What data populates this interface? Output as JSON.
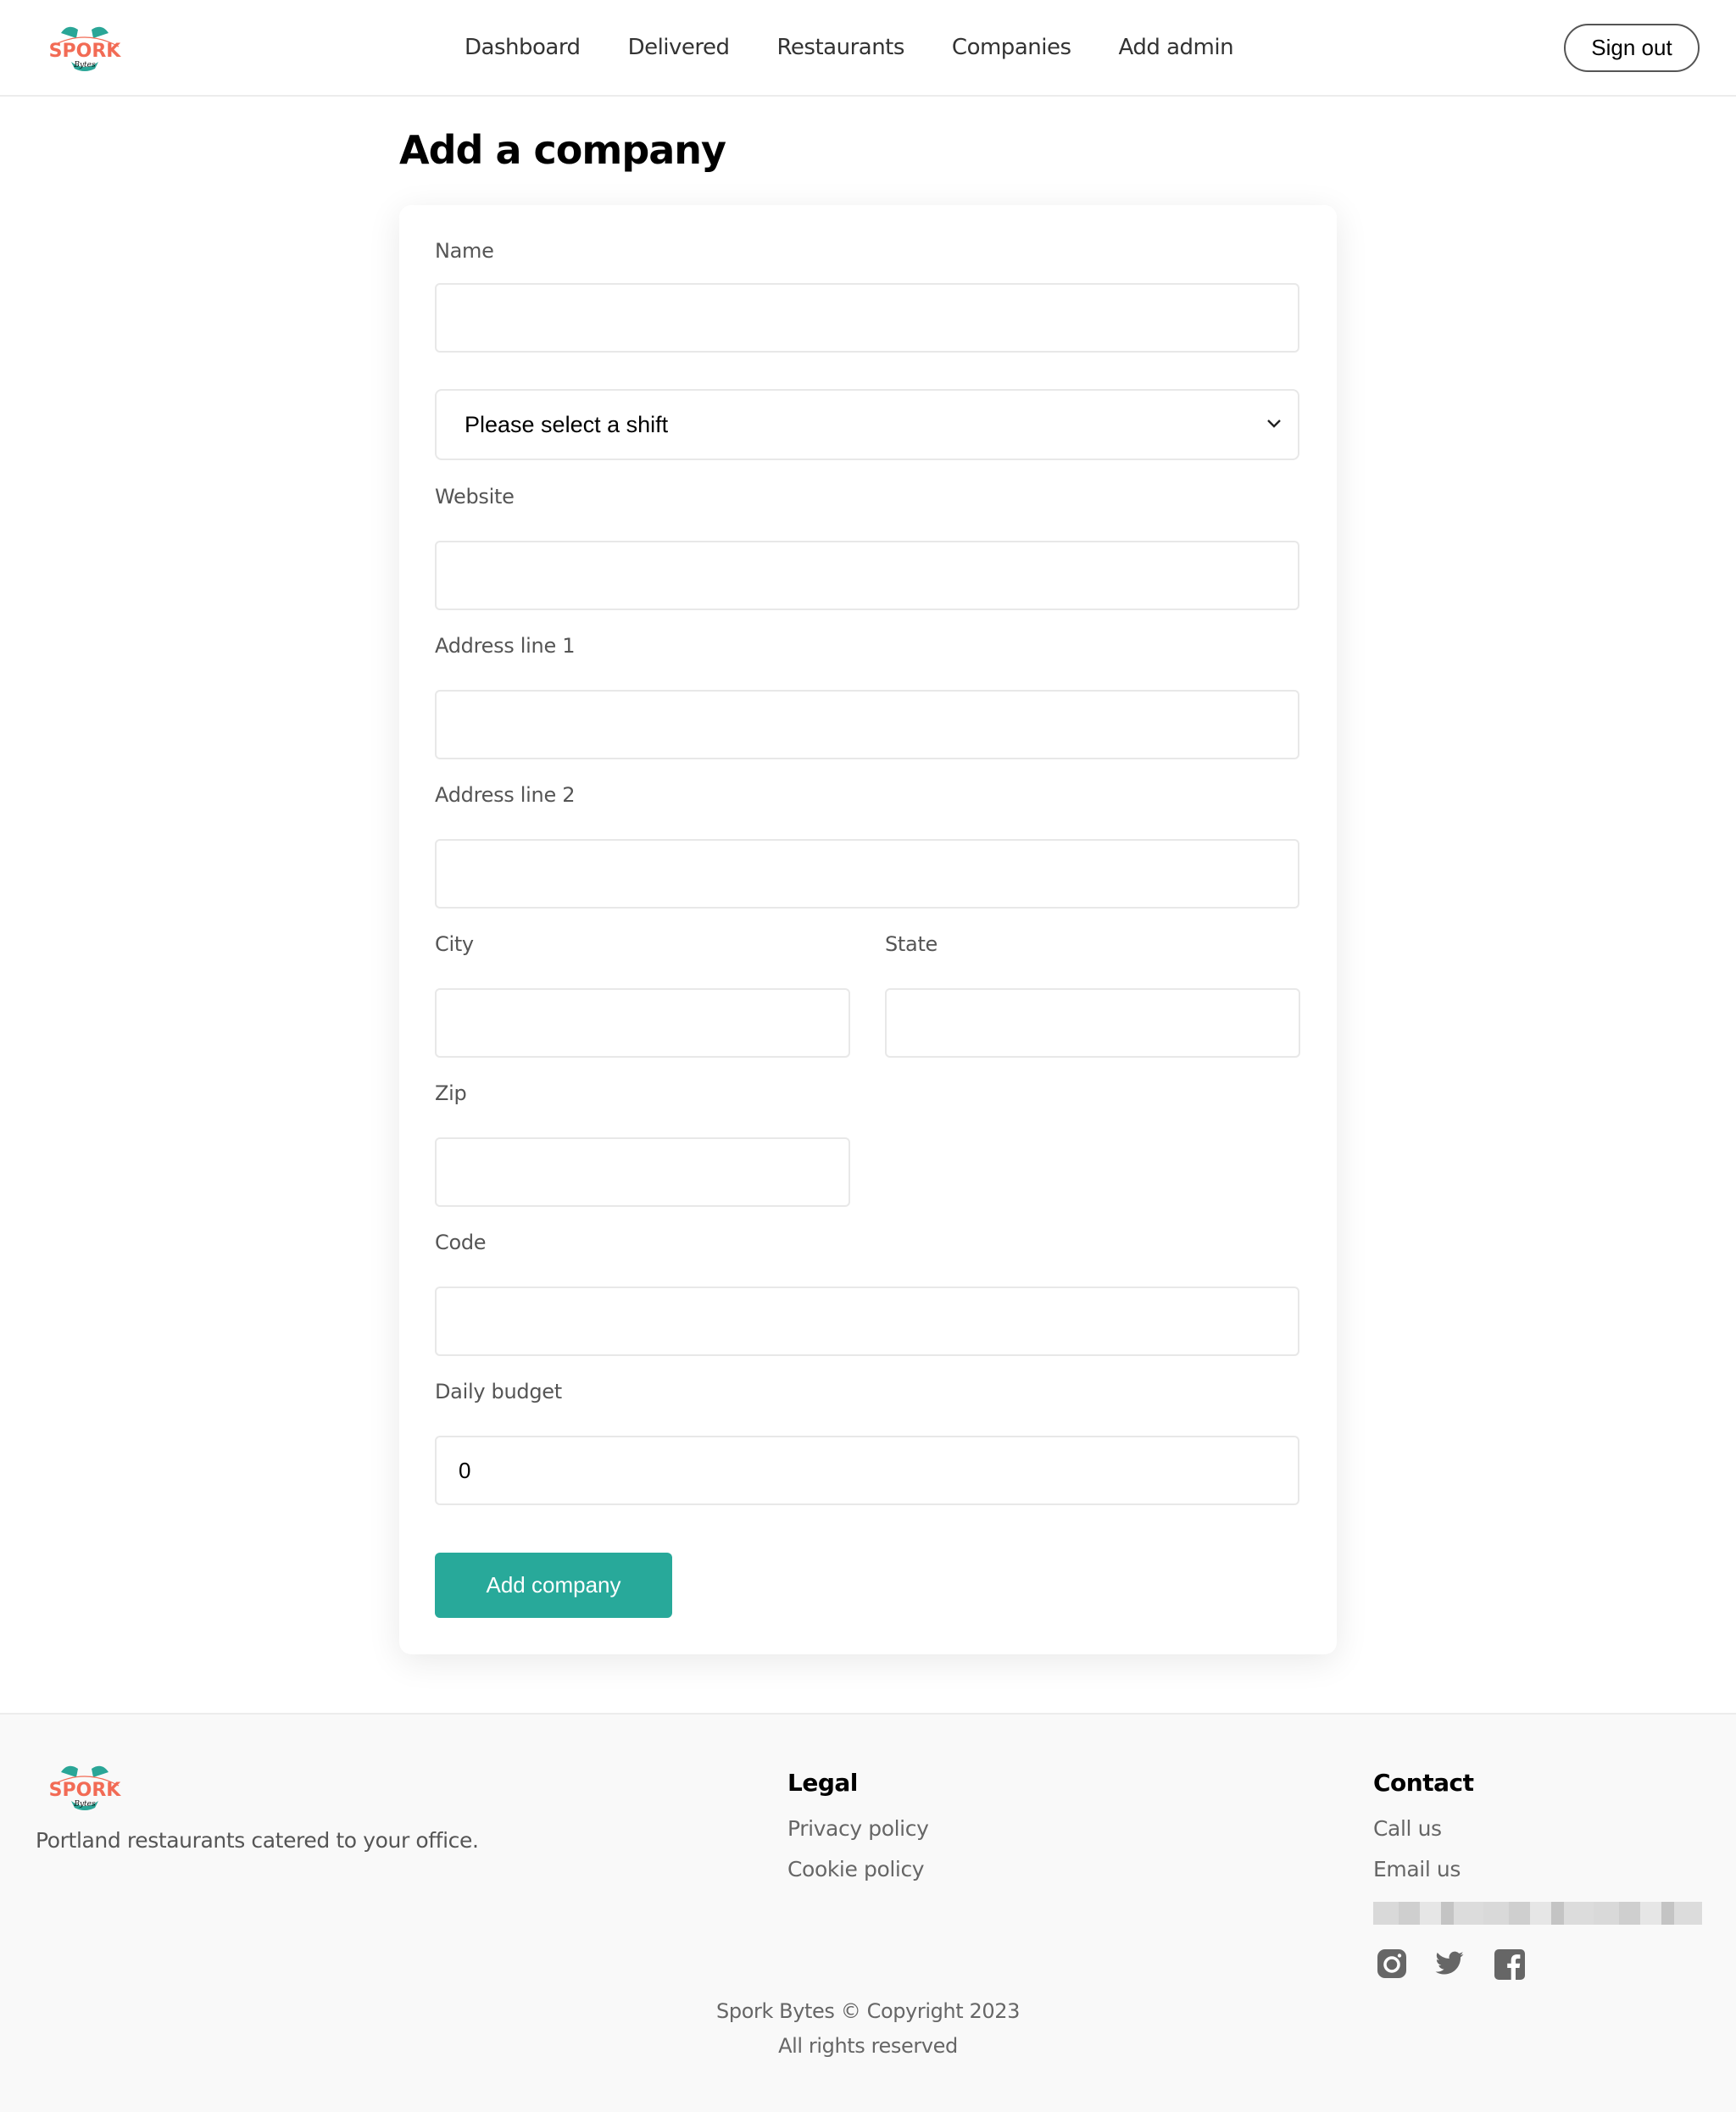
{
  "brand": {
    "name": "Spork Bytes",
    "logo_alt": "SPORK Bytes",
    "logo_word": "SPORK",
    "logo_sub": "Bytes",
    "accent": "#28a99a",
    "logo_coral": "#f26b55",
    "logo_teal": "#2aa697"
  },
  "header": {
    "nav": [
      {
        "label": "Dashboard"
      },
      {
        "label": "Delivered"
      },
      {
        "label": "Restaurants"
      },
      {
        "label": "Companies"
      },
      {
        "label": "Add admin"
      }
    ],
    "sign_out_label": "Sign out"
  },
  "page": {
    "title": "Add a company"
  },
  "form": {
    "name": {
      "label": "Name",
      "value": "",
      "placeholder": ""
    },
    "shift": {
      "selected": "Please select a shift",
      "icon": "chevron-down-icon"
    },
    "website": {
      "label": "Website",
      "value": "",
      "placeholder": ""
    },
    "address1": {
      "label": "Address line 1",
      "value": "",
      "placeholder": ""
    },
    "address2": {
      "label": "Address line 2",
      "value": "",
      "placeholder": ""
    },
    "city": {
      "label": "City",
      "value": "",
      "placeholder": ""
    },
    "state": {
      "label": "State",
      "value": "",
      "placeholder": ""
    },
    "zip": {
      "label": "Zip",
      "value": "",
      "placeholder": ""
    },
    "code": {
      "label": "Code",
      "value": "",
      "placeholder": ""
    },
    "daily_budget": {
      "label": "Daily budget",
      "value": "0",
      "placeholder": ""
    },
    "submit_label": "Add company"
  },
  "footer": {
    "tagline": "Portland restaurants catered to your office.",
    "legal": {
      "title": "Legal",
      "links": [
        {
          "label": "Privacy policy"
        },
        {
          "label": "Cookie policy"
        }
      ]
    },
    "contact": {
      "title": "Contact",
      "links": [
        {
          "label": "Call us"
        },
        {
          "label": "Email us"
        }
      ],
      "redacted": ""
    },
    "social": [
      {
        "icon": "instagram-icon"
      },
      {
        "icon": "twitter-icon"
      },
      {
        "icon": "facebook-icon"
      }
    ],
    "copyright": "Spork Bytes © Copyright 2023",
    "rights": "All rights reserved"
  }
}
